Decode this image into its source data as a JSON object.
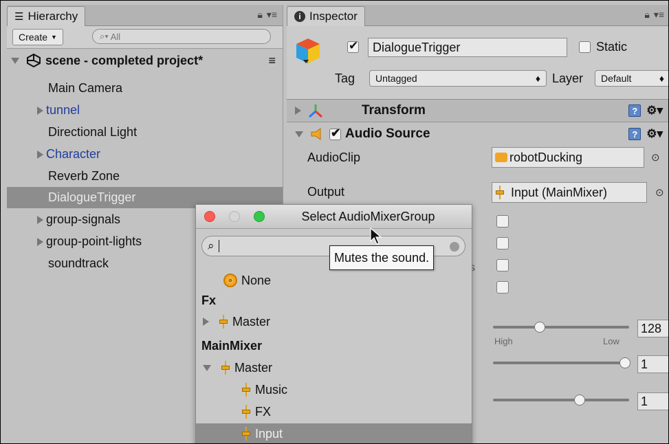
{
  "hierarchy": {
    "tab_label": "Hierarchy",
    "create_label": "Create",
    "search_placeholder": "All",
    "scene_name": "scene - completed project*",
    "items": [
      {
        "label": "Main Camera"
      },
      {
        "label": "tunnel"
      },
      {
        "label": "Directional Light"
      },
      {
        "label": "Character"
      },
      {
        "label": "Reverb Zone"
      },
      {
        "label": "DialogueTrigger"
      },
      {
        "label": "group-signals"
      },
      {
        "label": "group-point-lights"
      },
      {
        "label": "soundtrack"
      }
    ]
  },
  "inspector": {
    "tab_label": "Inspector",
    "object_name": "DialogueTrigger",
    "static_label": "Static",
    "tag_label": "Tag",
    "tag_value": "Untagged",
    "layer_label": "Layer",
    "layer_value": "Default",
    "transform_label": "Transform",
    "audio_source_label": "Audio Source",
    "audioclip_label": "AudioClip",
    "audioclip_value": "robotDucking",
    "output_label": "Output",
    "output_value": "Input (MainMixer)",
    "priority_value": "128",
    "high_label": "High",
    "low_label": "Low",
    "volume_value": "1",
    "pitch_value": "1",
    "priority_partial_s": "s"
  },
  "popup": {
    "title": "Select AudioMixerGroup",
    "search_value": "",
    "none_label": "None",
    "items": [
      {
        "label": "Fx"
      },
      {
        "label": "Master"
      },
      {
        "label": "MainMixer"
      },
      {
        "label": "Master"
      },
      {
        "label": "Music"
      },
      {
        "label": "FX"
      },
      {
        "label": "Input"
      }
    ]
  },
  "tooltip": {
    "text": "Mutes the sound."
  },
  "colors": {
    "selection": "#8d8d8d",
    "prefab_blue": "#1f3d9e",
    "mixer_orange": "#e7a61c"
  }
}
